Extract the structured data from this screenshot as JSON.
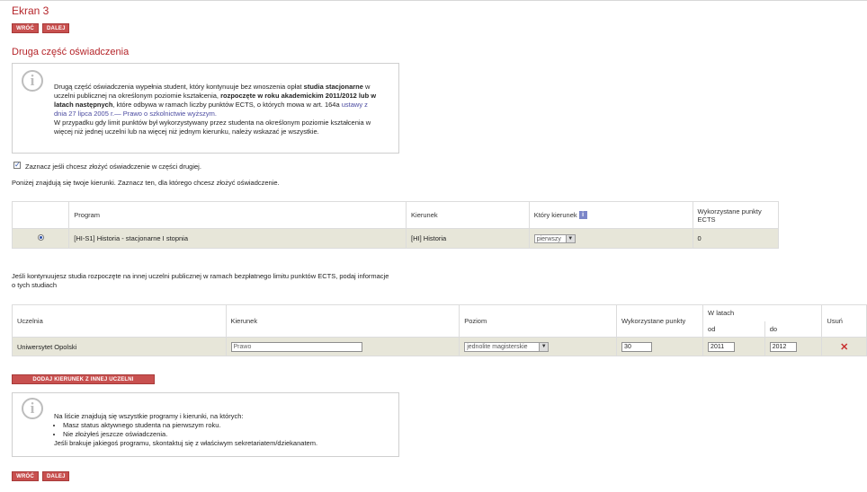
{
  "page": {
    "title": "Ekran 3",
    "back_label": "WRÓĆ",
    "next_label": "DALEJ",
    "section_title": "Druga część oświadczenia"
  },
  "info1": {
    "t1": "Drugą część oświadczenia wypełnia student, który kontynuuje bez wnoszenia opłat ",
    "b1": "studia stacjonarne",
    "t2": " w uczelni publicznej na określonym poziomie kształcenia, ",
    "b2": "rozpoczęte w roku akademickim 2011/2012 lub w latach następnych",
    "t3": ", które odbywa w ramach liczby punktów ECTS, o których mowa w art. 164a ",
    "link": "ustawy z dnia 27 lipca 2005 r.— Prawo o szkolnictwie wyższym.",
    "t4": "W przypadku gdy limit punktów był wykorzystywany przez studenta na określonym poziomie kształcenia w więcej niż jednej uczelni lub na więcej niż jednym kierunku, należy wskazać je wszystkie."
  },
  "checkbox_label": "Zaznacz jeśli chcesz złożyć oświadczenie w części drugiej.",
  "directions_intro": "Poniżej znajdują się twoje kierunki. Zaznacz ten, dla którego chcesz złożyć oświadczenie.",
  "table1": {
    "headers": [
      "Program",
      "Kierunek",
      "Który kierunek",
      "Wykorzystane punkty ECTS"
    ],
    "row": {
      "program": "[HI-S1] Historia - stacjonarne I stopnia",
      "kierunek": "[HI] Historia",
      "ktory": "pierwszy",
      "punkty": "0"
    },
    "info_glyph": "i"
  },
  "other_uni_text": "Jeśli kontynuujesz studia rozpoczęte na innej uczelni publicznej w ramach bezpłatnego limitu punktów ECTS, podaj informacje o tych studiach",
  "table2": {
    "headers": {
      "uczelnia": "Uczelnia",
      "kierunek": "Kierunek",
      "poziom": "Poziom",
      "punkty": "Wykorzystane punkty",
      "w_latach": "W latach",
      "od": "od",
      "do": "do",
      "usun": "Usuń"
    },
    "row": {
      "uczelnia": "Uniwersytet Opolski",
      "kierunek": "Prawo",
      "poziom": "jednolite magisterskie",
      "punkty": "30",
      "od": "2011",
      "do": "2012"
    }
  },
  "add_button_label": "DODAJ KIERUNEK Z INNEJ UCZELNI PUBLICZNEJ",
  "info2": {
    "line1": "Na liście znajdują się wszystkie programy i kierunki, na których:",
    "bullets": [
      "Masz status aktywnego studenta na pierwszym roku.",
      "Nie złożyłeś jeszcze oświadczenia."
    ],
    "line2": "Jeśli brakuje jakiegoś programu, skontaktuj się z właściwym sekretariatem/dziekanatem."
  },
  "icons": {
    "info": "info-circle-icon",
    "delete": "close-icon",
    "dropdown": "chevron-down-icon"
  },
  "colors": {
    "accent": "#c8504f",
    "title": "#b5252a",
    "row_bg": "#e7e6d9",
    "link": "#4a4aa0"
  }
}
